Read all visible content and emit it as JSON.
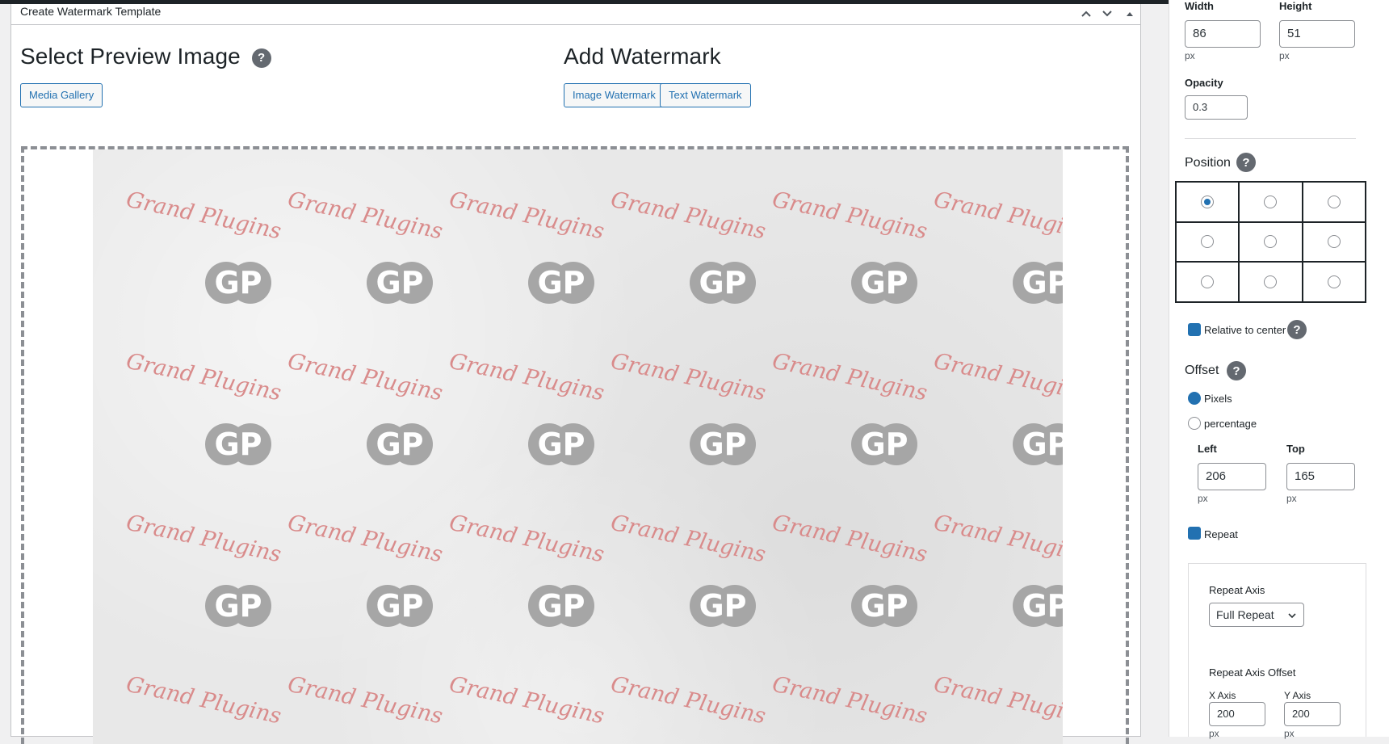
{
  "postbox": {
    "title": "Create Watermark Template"
  },
  "preview": {
    "heading": "Select Preview Image",
    "help": "?",
    "media_gallery_label": "Media Gallery"
  },
  "add_watermark": {
    "heading": "Add Watermark",
    "image_watermark_label": "Image Watermark",
    "text_watermark_label": "Text Watermark"
  },
  "watermark": {
    "text_mark": "Grand Plugins",
    "logo_mark": "GP",
    "text_color": "#d98b8b",
    "logo_color": "#a6a6a6"
  },
  "settings": {
    "width_label": "Width",
    "width_value": "86",
    "width_unit": "px",
    "height_label": "Height",
    "height_value": "51",
    "height_unit": "px",
    "opacity_label": "Opacity",
    "opacity_value": "0.3",
    "position_label": "Position",
    "position_help": "?",
    "relative_label": "Relative to center",
    "relative_help": "?",
    "offset_label": "Offset",
    "offset_help": "?",
    "pixels_label": "Pixels",
    "percentage_label": "percentage",
    "left_label": "Left",
    "left_value": "206",
    "left_unit": "px",
    "top_label": "Top",
    "top_value": "165",
    "top_unit": "px",
    "repeat_label": "Repeat",
    "repeat_axis_label": "Repeat Axis",
    "repeat_axis_value": "Full Repeat",
    "repeat_axis_offset_label": "Repeat Axis Offset",
    "x_axis_label": "X Axis",
    "x_axis_value": "200",
    "x_axis_unit": "px",
    "y_axis_label": "Y Axis",
    "y_axis_value": "200",
    "y_axis_unit": "px"
  },
  "colors": {
    "accent": "#2271b1",
    "help_badge": "#646970"
  }
}
